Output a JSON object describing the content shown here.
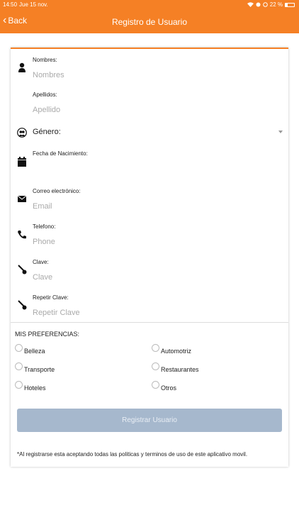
{
  "status_bar": {
    "time": "14:50",
    "date": "Jue 15 nov.",
    "battery": "22 %",
    "battery_level": 0.22
  },
  "nav": {
    "back_label": "Back",
    "title": "Registro de Usuario"
  },
  "form": {
    "nombres": {
      "label": "Nombres:",
      "placeholder": "Nombres"
    },
    "apellidos": {
      "label": "Apellidos:",
      "placeholder": "Apellido"
    },
    "genero": {
      "label": "Género:"
    },
    "fecha": {
      "label": "Fecha de Nacimiento:"
    },
    "correo": {
      "label": "Correo electrónico:",
      "placeholder": "Email"
    },
    "telefono": {
      "label": "Telefono:",
      "placeholder": "Phone"
    },
    "clave": {
      "label": "Clave:",
      "placeholder": "Clave"
    },
    "repetir": {
      "label": "Repetir Clave:",
      "placeholder": "Repetir Clave"
    }
  },
  "preferences": {
    "title": "MIS PREFERENCIAS:",
    "items": [
      "Belleza",
      "Automotriz",
      "Transporte",
      "Restaurantes",
      "Hoteles",
      "Otros"
    ]
  },
  "submit_label": "Registrar Usuario",
  "terms": "*Al registrarse esta aceptando todas las politicas y terminos de uso de este aplicativo movil.",
  "colors": {
    "accent": "#f58025",
    "button": "#a6b8cd"
  }
}
